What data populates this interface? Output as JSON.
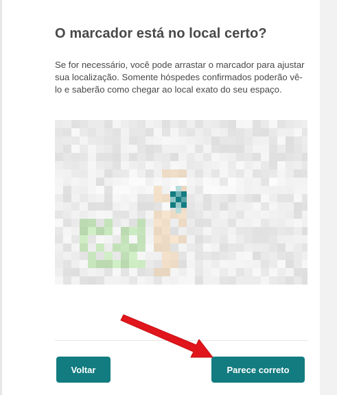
{
  "dialog": {
    "title": "O marcador está no local certo?",
    "description": "Se for necessário, você pode arrastar o marcador para ajustar sua localização. Somente hóspedes confirmados poderão vê-lo e saberão como chegar ao local exato do seu espaço."
  },
  "map": {
    "marker_icon": "location-marker-icon",
    "accent_color": "#127c80"
  },
  "actions": {
    "back_label": "Voltar",
    "confirm_label": "Parece correto"
  },
  "annotation": {
    "arrow_icon": "red-arrow-icon",
    "color": "#e0161c"
  }
}
